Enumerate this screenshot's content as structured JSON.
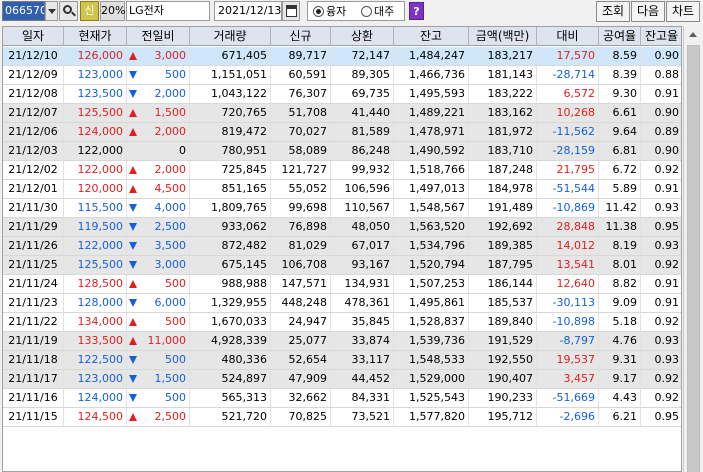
{
  "toolbar": {
    "stock_code": "066570",
    "new_label": "신",
    "percent": "20%",
    "stock_name": "LG전자",
    "date": "2021/12/13",
    "radio_options": [
      "융자",
      "대주"
    ],
    "radio_selected": 0,
    "help_label": "?",
    "buttons": {
      "query": "조회",
      "next": "다음",
      "chart": "차트"
    }
  },
  "table": {
    "columns": [
      "일자",
      "현재가",
      "전일비",
      "거래량",
      "신규",
      "상환",
      "잔고",
      "금액(백만)",
      "대비",
      "공여율",
      "잔고율"
    ],
    "rows": [
      {
        "date": "21/12/10",
        "price": "126,000",
        "dir": "up",
        "change": "3,000",
        "volume": "671,405",
        "new": "89,717",
        "repay": "72,147",
        "balance": "1,484,247",
        "amount": "183,217",
        "diff": "17,570",
        "diff_sign": "pos",
        "supply": "8.59",
        "bal_rate": "0.90",
        "style": "selected"
      },
      {
        "date": "21/12/09",
        "price": "123,000",
        "dir": "down",
        "change": "500",
        "volume": "1,151,051",
        "new": "60,591",
        "repay": "89,305",
        "balance": "1,466,736",
        "amount": "181,143",
        "diff": "-28,714",
        "diff_sign": "neg",
        "supply": "8.39",
        "bal_rate": "0.88",
        "style": "plain"
      },
      {
        "date": "21/12/08",
        "price": "123,500",
        "dir": "down",
        "change": "2,000",
        "volume": "1,043,122",
        "new": "76,307",
        "repay": "69,735",
        "balance": "1,495,593",
        "amount": "183,222",
        "diff": "6,572",
        "diff_sign": "pos",
        "supply": "9.30",
        "bal_rate": "0.91",
        "style": "plain"
      },
      {
        "date": "21/12/07",
        "price": "125,500",
        "dir": "up",
        "change": "1,500",
        "volume": "720,765",
        "new": "51,708",
        "repay": "41,440",
        "balance": "1,489,221",
        "amount": "183,162",
        "diff": "10,268",
        "diff_sign": "pos",
        "supply": "6.61",
        "bal_rate": "0.90",
        "style": "shade"
      },
      {
        "date": "21/12/06",
        "price": "124,000",
        "dir": "up",
        "change": "2,000",
        "volume": "819,472",
        "new": "70,027",
        "repay": "81,589",
        "balance": "1,478,971",
        "amount": "181,972",
        "diff": "-11,562",
        "diff_sign": "neg",
        "supply": "9.64",
        "bal_rate": "0.89",
        "style": "shade"
      },
      {
        "date": "21/12/03",
        "price": "122,000",
        "dir": "none",
        "change": "0",
        "volume": "780,951",
        "new": "58,089",
        "repay": "86,248",
        "balance": "1,490,592",
        "amount": "183,710",
        "diff": "-28,159",
        "diff_sign": "neg",
        "supply": "6.81",
        "bal_rate": "0.90",
        "style": "shade"
      },
      {
        "date": "21/12/02",
        "price": "122,000",
        "dir": "up",
        "change": "2,000",
        "volume": "725,845",
        "new": "121,727",
        "repay": "99,932",
        "balance": "1,518,766",
        "amount": "187,248",
        "diff": "21,795",
        "diff_sign": "pos",
        "supply": "6.72",
        "bal_rate": "0.92",
        "style": "plain"
      },
      {
        "date": "21/12/01",
        "price": "120,000",
        "dir": "up",
        "change": "4,500",
        "volume": "851,165",
        "new": "55,052",
        "repay": "106,596",
        "balance": "1,497,013",
        "amount": "184,978",
        "diff": "-51,544",
        "diff_sign": "neg",
        "supply": "5.89",
        "bal_rate": "0.91",
        "style": "plain"
      },
      {
        "date": "21/11/30",
        "price": "115,500",
        "dir": "down",
        "change": "4,000",
        "volume": "1,809,765",
        "new": "99,698",
        "repay": "110,567",
        "balance": "1,548,567",
        "amount": "191,489",
        "diff": "-10,869",
        "diff_sign": "neg",
        "supply": "11.42",
        "bal_rate": "0.93",
        "style": "plain"
      },
      {
        "date": "21/11/29",
        "price": "119,500",
        "dir": "down",
        "change": "2,500",
        "volume": "933,062",
        "new": "76,898",
        "repay": "48,050",
        "balance": "1,563,520",
        "amount": "192,692",
        "diff": "28,848",
        "diff_sign": "pos",
        "supply": "11.38",
        "bal_rate": "0.95",
        "style": "shade"
      },
      {
        "date": "21/11/26",
        "price": "122,000",
        "dir": "down",
        "change": "3,500",
        "volume": "872,482",
        "new": "81,029",
        "repay": "67,017",
        "balance": "1,534,796",
        "amount": "189,385",
        "diff": "14,012",
        "diff_sign": "pos",
        "supply": "8.19",
        "bal_rate": "0.93",
        "style": "shade"
      },
      {
        "date": "21/11/25",
        "price": "125,500",
        "dir": "down",
        "change": "3,000",
        "volume": "675,145",
        "new": "106,708",
        "repay": "93,167",
        "balance": "1,520,794",
        "amount": "187,795",
        "diff": "13,541",
        "diff_sign": "pos",
        "supply": "8.01",
        "bal_rate": "0.92",
        "style": "shade"
      },
      {
        "date": "21/11/24",
        "price": "128,500",
        "dir": "up",
        "change": "500",
        "volume": "988,988",
        "new": "147,571",
        "repay": "134,931",
        "balance": "1,507,253",
        "amount": "186,144",
        "diff": "12,640",
        "diff_sign": "pos",
        "supply": "8.82",
        "bal_rate": "0.91",
        "style": "plain"
      },
      {
        "date": "21/11/23",
        "price": "128,000",
        "dir": "down",
        "change": "6,000",
        "volume": "1,329,955",
        "new": "448,248",
        "repay": "478,361",
        "balance": "1,495,861",
        "amount": "185,537",
        "diff": "-30,113",
        "diff_sign": "neg",
        "supply": "9.09",
        "bal_rate": "0.91",
        "style": "plain"
      },
      {
        "date": "21/11/22",
        "price": "134,000",
        "dir": "up",
        "change": "500",
        "volume": "1,670,033",
        "new": "24,947",
        "repay": "35,845",
        "balance": "1,528,837",
        "amount": "189,840",
        "diff": "-10,898",
        "diff_sign": "neg",
        "supply": "5.18",
        "bal_rate": "0.92",
        "style": "plain"
      },
      {
        "date": "21/11/19",
        "price": "133,500",
        "dir": "up",
        "change": "11,000",
        "volume": "4,928,339",
        "new": "25,077",
        "repay": "33,874",
        "balance": "1,539,736",
        "amount": "191,529",
        "diff": "-8,797",
        "diff_sign": "neg",
        "supply": "4.76",
        "bal_rate": "0.93",
        "style": "shade"
      },
      {
        "date": "21/11/18",
        "price": "122,500",
        "dir": "down",
        "change": "500",
        "volume": "480,336",
        "new": "52,654",
        "repay": "33,117",
        "balance": "1,548,533",
        "amount": "192,550",
        "diff": "19,537",
        "diff_sign": "pos",
        "supply": "9.31",
        "bal_rate": "0.93",
        "style": "shade"
      },
      {
        "date": "21/11/17",
        "price": "123,000",
        "dir": "down",
        "change": "1,500",
        "volume": "524,897",
        "new": "47,909",
        "repay": "44,452",
        "balance": "1,529,000",
        "amount": "190,407",
        "diff": "3,457",
        "diff_sign": "pos",
        "supply": "9.17",
        "bal_rate": "0.92",
        "style": "shade"
      },
      {
        "date": "21/11/16",
        "price": "124,000",
        "dir": "down",
        "change": "500",
        "volume": "565,313",
        "new": "32,662",
        "repay": "84,331",
        "balance": "1,525,543",
        "amount": "190,233",
        "diff": "-51,669",
        "diff_sign": "neg",
        "supply": "4.43",
        "bal_rate": "0.92",
        "style": "plain"
      },
      {
        "date": "21/11/15",
        "price": "124,500",
        "dir": "up",
        "change": "2,500",
        "volume": "521,720",
        "new": "70,825",
        "repay": "73,521",
        "balance": "1,577,820",
        "amount": "195,712",
        "diff": "-2,696",
        "diff_sign": "neg",
        "supply": "6.21",
        "bal_rate": "0.95",
        "style": "plain"
      }
    ]
  }
}
